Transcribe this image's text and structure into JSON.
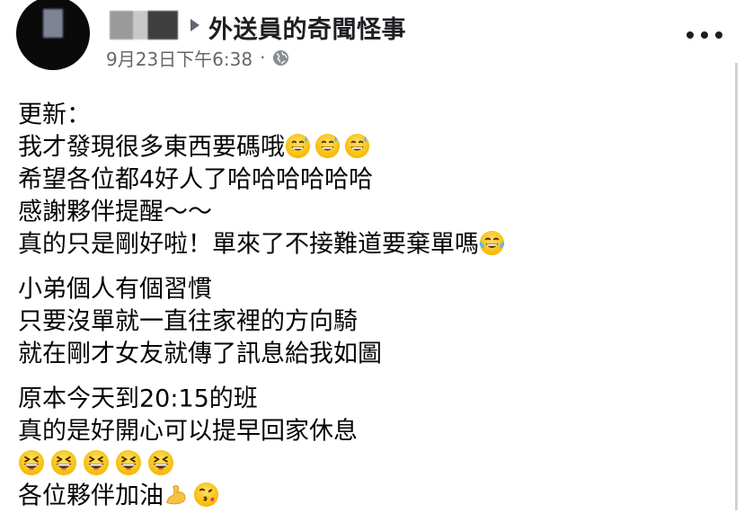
{
  "post": {
    "group_name": "外送員的奇聞怪事",
    "timestamp": "9月23日下午6:38",
    "separator": "·",
    "privacy_icon": "globe-icon",
    "menu_icon": "more-options-icon"
  },
  "content": {
    "p1_l1": "更新：",
    "p1_l2": "我才發現很多東西要碼哦",
    "p1_l3": "希望各位都4好人了哈哈哈哈哈哈",
    "p1_l4": "感謝夥伴提醒～～",
    "p1_l5": "真的只是剛好啦！單來了不接難道要棄單嗎",
    "p2_l1": "小弟個人有個習慣",
    "p2_l2": "只要沒單就一直往家裡的方向騎",
    "p2_l3": "就在剛才女友就傳了訊息給我如圖",
    "p3_l1": "原本今天到20:15的班",
    "p3_l2": "真的是好開心可以提早回家休息",
    "p3_l4": "各位夥伴加油"
  },
  "emojis": {
    "sweat_smile": "grinning-sweat-emoji",
    "joy": "tears-of-joy-emoji",
    "laughing": "laughing-squint-emoji",
    "muscle": "flexed-biceps-emoji",
    "kiss": "blowing-kiss-emoji"
  },
  "colors": {
    "text": "#050505",
    "meta": "#65676b",
    "emoji_yellow": "#ffcc33"
  }
}
